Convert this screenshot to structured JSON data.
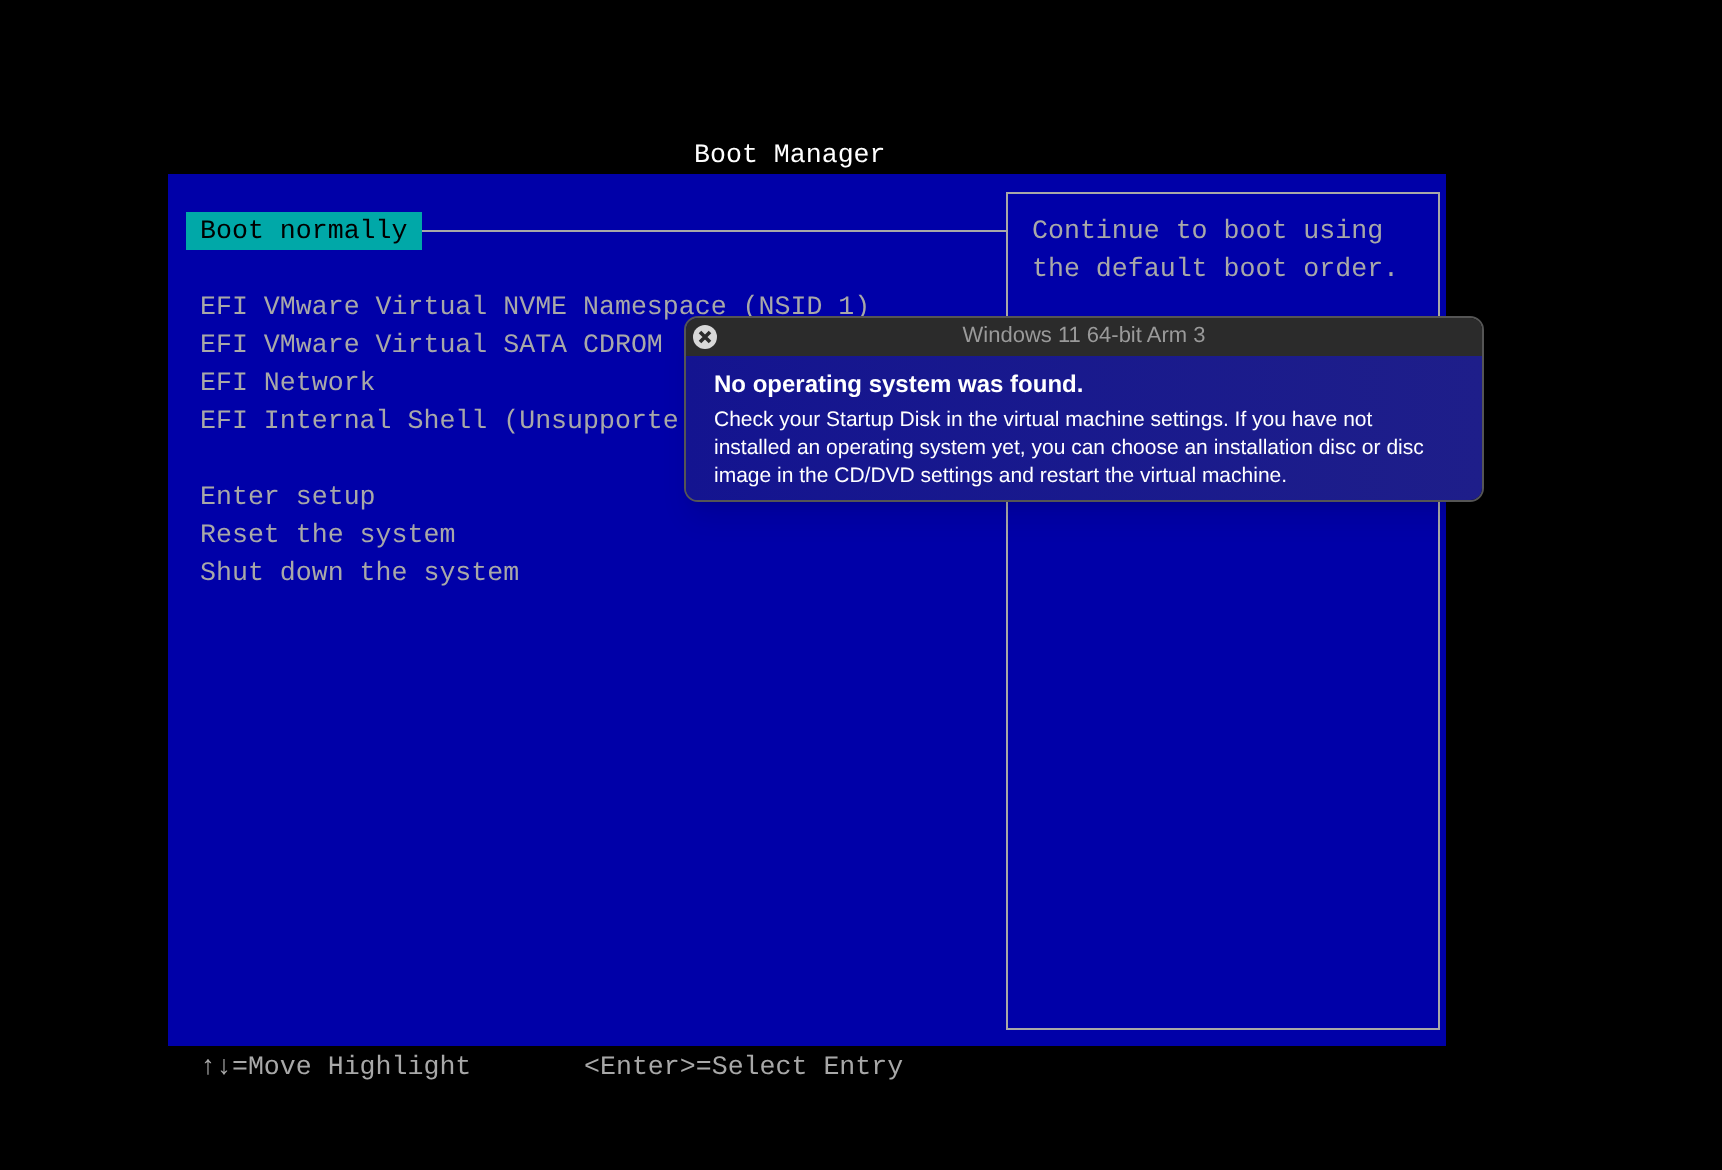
{
  "title": "Boot Manager",
  "menu_groups": [
    [
      {
        "label": "Boot normally",
        "selected": true
      }
    ],
    [
      {
        "label": "EFI VMware Virtual NVME Namespace (NSID 1)",
        "selected": false
      },
      {
        "label": "EFI VMware Virtual SATA CDROM",
        "selected": false
      },
      {
        "label": "EFI Network",
        "selected": false
      },
      {
        "label": "EFI Internal Shell (Unsupporte",
        "selected": false
      }
    ],
    [
      {
        "label": "Enter setup",
        "selected": false
      },
      {
        "label": "Reset the system",
        "selected": false
      },
      {
        "label": "Shut down the system",
        "selected": false
      }
    ]
  ],
  "help_text": [
    "Continue to boot using",
    "the default boot order."
  ],
  "footer": [
    "↑↓=Move Highlight",
    "<Enter>=Select Entry"
  ],
  "alert": {
    "title": "Windows 11 64-bit Arm 3",
    "heading": "No operating system was found.",
    "message": "Check your Startup Disk in the virtual machine settings. If you have not installed an operating system yet, you can choose an installation disc or disc image in the CD/DVD settings and restart the virtual machine."
  }
}
